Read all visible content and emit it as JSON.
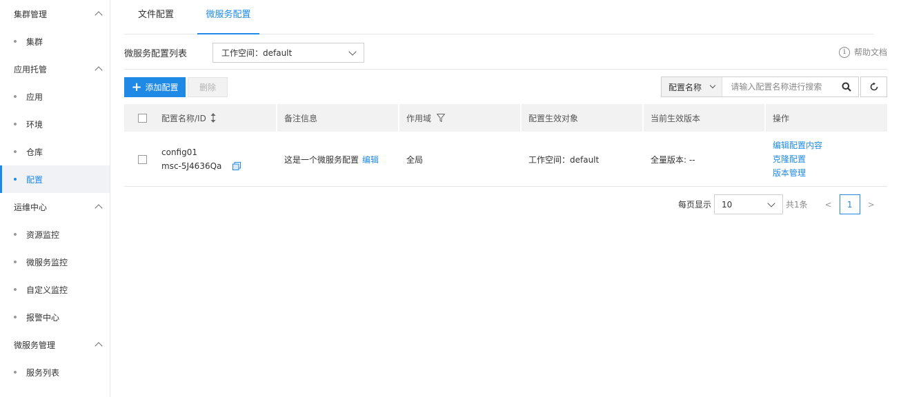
{
  "sidebar": {
    "groups": [
      {
        "label": "集群管理",
        "items": [
          "集群"
        ]
      },
      {
        "label": "应用托管",
        "items": [
          "应用",
          "环境",
          "仓库",
          "配置"
        ]
      },
      {
        "label": "运维中心",
        "items": [
          "资源监控",
          "微服务监控",
          "自定义监控",
          "报警中心"
        ]
      },
      {
        "label": "微服务管理",
        "items": [
          "服务列表"
        ]
      }
    ],
    "active_item": "配置"
  },
  "tabs": [
    "文件配置",
    "微服务配置"
  ],
  "active_tab": "微服务配置",
  "toolbar": {
    "list_title": "微服务配置列表",
    "workspace_select": "工作空间：default",
    "help_label": "帮助文档",
    "add_label": "添加配置",
    "delete_label": "删除",
    "search_field": "配置名称",
    "search_placeholder": "请输入配置名称进行搜索"
  },
  "table": {
    "headers": [
      "配置名称/ID",
      "备注信息",
      "作用域",
      "配置生效对象",
      "当前生效版本",
      "操作"
    ],
    "rows": [
      {
        "name": "config01",
        "id": "msc-5J4636Qa",
        "remark": "这是一个微服务配置",
        "remark_edit": "编辑",
        "scope": "全局",
        "target": "工作空间：default",
        "version": "全量版本: --",
        "ops": [
          "编辑配置内容",
          "克隆配置",
          "版本管理"
        ]
      }
    ]
  },
  "pagination": {
    "per_page_label": "每页显示",
    "per_page": "10",
    "total": "共1条",
    "prev": "<",
    "current": "1",
    "next": ">"
  },
  "colors": {
    "accent": "#1f8ae6"
  }
}
